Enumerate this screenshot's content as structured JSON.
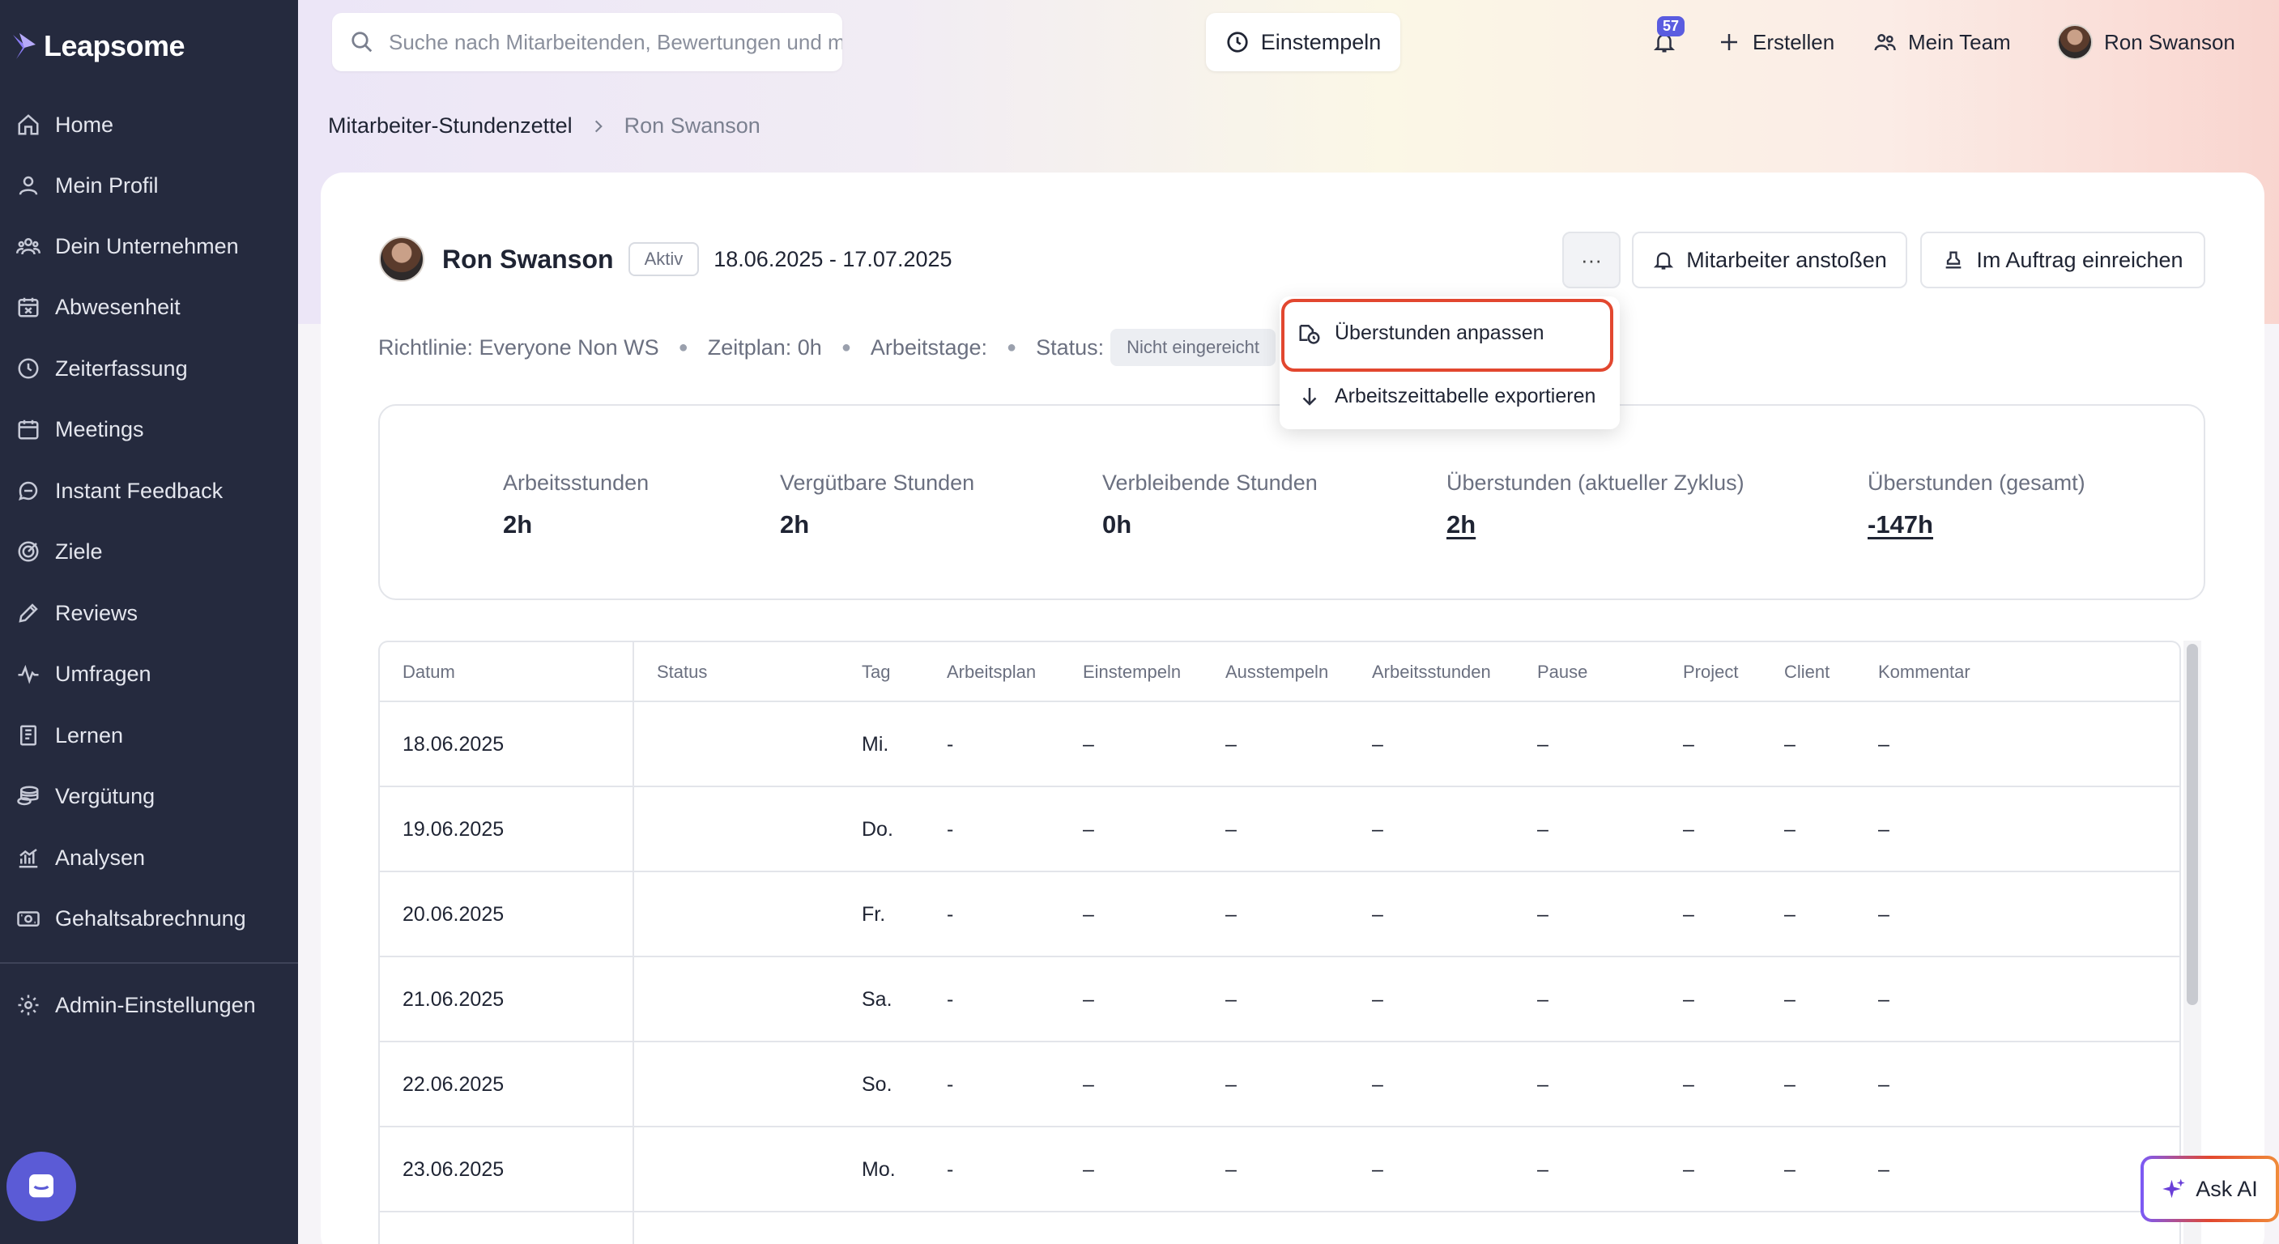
{
  "app": {
    "brand": "Leapsome"
  },
  "sidebar": {
    "items": [
      {
        "label": "Home",
        "icon": "home-icon"
      },
      {
        "label": "Mein Profil",
        "icon": "user-icon"
      },
      {
        "label": "Dein Unternehmen",
        "icon": "users-icon"
      },
      {
        "label": "Abwesenheit",
        "icon": "calendar-x-icon"
      },
      {
        "label": "Zeiterfassung",
        "icon": "clock-icon"
      },
      {
        "label": "Meetings",
        "icon": "calendar-icon"
      },
      {
        "label": "Instant Feedback",
        "icon": "chat-icon"
      },
      {
        "label": "Ziele",
        "icon": "target-icon"
      },
      {
        "label": "Reviews",
        "icon": "pencil-icon"
      },
      {
        "label": "Umfragen",
        "icon": "pulse-icon"
      },
      {
        "label": "Lernen",
        "icon": "book-icon"
      },
      {
        "label": "Vergütung",
        "icon": "coins-icon"
      },
      {
        "label": "Analysen",
        "icon": "chart-icon"
      },
      {
        "label": "Gehaltsabrechnung",
        "icon": "money-icon"
      }
    ],
    "admin": {
      "label": "Admin-Einstellungen",
      "icon": "gear-icon"
    }
  },
  "header": {
    "search_placeholder": "Suche nach Mitarbeitenden, Bewertungen und mehr",
    "clock_in": "Einstempeln",
    "notification_count": "57",
    "create": "Erstellen",
    "my_team": "Mein Team",
    "user_name": "Ron Swanson"
  },
  "breadcrumb": {
    "parent": "Mitarbeiter-Stundenzettel",
    "current": "Ron Swanson"
  },
  "profile": {
    "name": "Ron Swanson",
    "status_badge": "Aktiv",
    "date_range": "18.06.2025 - 17.07.2025",
    "policy": "Richtlinie: Everyone Non WS",
    "schedule": "Zeitplan: 0h",
    "workdays": "Arbeitstage:",
    "status_label": "Status:",
    "status_value": "Nicht eingereicht"
  },
  "actions": {
    "more": "···",
    "nudge": "Mitarbeiter anstoßen",
    "submit_on_behalf": "Im Auftrag einreichen"
  },
  "dropdown": {
    "items": [
      {
        "label": "Überstunden anpassen",
        "icon": "clock-edit-icon"
      },
      {
        "label": "Arbeitszeittabelle exportieren",
        "icon": "arrow-down-icon"
      }
    ]
  },
  "stats": [
    {
      "label": "Arbeitsstunden",
      "value": "2h"
    },
    {
      "label": "Vergütbare Stunden",
      "value": "2h"
    },
    {
      "label": "Verbleibende Stunden",
      "value": "0h"
    },
    {
      "label": "Überstunden (aktueller Zyklus)",
      "value": "2h"
    },
    {
      "label": "Überstunden (gesamt)",
      "value": "-147h"
    }
  ],
  "table": {
    "columns": [
      "Datum",
      "Status",
      "Tag",
      "Arbeitsplan",
      "Einstempeln",
      "Ausstempeln",
      "Arbeitsstunden",
      "Pause",
      "Project",
      "Client",
      "Kommentar"
    ],
    "rows": [
      {
        "date": "18.06.2025",
        "status": "",
        "day": "Mi.",
        "plan": "-",
        "in": "–",
        "out": "–",
        "hours": "–",
        "pause": "–",
        "project": "–",
        "client": "–",
        "comment": "–"
      },
      {
        "date": "19.06.2025",
        "status": "",
        "day": "Do.",
        "plan": "-",
        "in": "–",
        "out": "–",
        "hours": "–",
        "pause": "–",
        "project": "–",
        "client": "–",
        "comment": "–"
      },
      {
        "date": "20.06.2025",
        "status": "",
        "day": "Fr.",
        "plan": "-",
        "in": "–",
        "out": "–",
        "hours": "–",
        "pause": "–",
        "project": "–",
        "client": "–",
        "comment": "–"
      },
      {
        "date": "21.06.2025",
        "status": "",
        "day": "Sa.",
        "plan": "-",
        "in": "–",
        "out": "–",
        "hours": "–",
        "pause": "–",
        "project": "–",
        "client": "–",
        "comment": "–"
      },
      {
        "date": "22.06.2025",
        "status": "",
        "day": "So.",
        "plan": "-",
        "in": "–",
        "out": "–",
        "hours": "–",
        "pause": "–",
        "project": "–",
        "client": "–",
        "comment": "–"
      },
      {
        "date": "23.06.2025",
        "status": "",
        "day": "Mo.",
        "plan": "-",
        "in": "–",
        "out": "–",
        "hours": "–",
        "pause": "–",
        "project": "–",
        "client": "–",
        "comment": "–"
      }
    ]
  },
  "ask_ai": "Ask AI",
  "colors": {
    "sidebar_bg": "#252a3e",
    "accent": "#5a5ce0",
    "highlight": "#e2472f"
  }
}
